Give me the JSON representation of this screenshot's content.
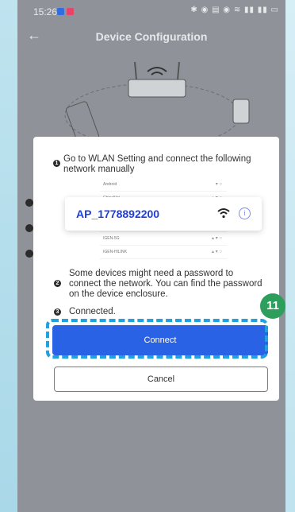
{
  "status_bar": {
    "time": "15:26",
    "right_indicators": "✱ ◉ ▤ ◉ ≋ ▮▮ ▮▮ ▭"
  },
  "app_bar": {
    "back_icon": "←",
    "title": "Device Configuration"
  },
  "modal": {
    "step1": {
      "number": "1",
      "text": "Go to WLAN Setting and connect the following network manually"
    },
    "wifi_list_rows": [
      "Android",
      "ChinaNet",
      "",
      "IGEN-5G",
      "IGEN-HILINK"
    ],
    "ap_card": {
      "ssid": "AP_1778892200",
      "info_icon": "i"
    },
    "step2": {
      "number": "2",
      "text": "Some devices might need a password to connect the network. You can find the password on the device enclosure."
    },
    "step3": {
      "number": "3",
      "text": "Connected."
    },
    "connect_label": "Connect",
    "cancel_label": "Cancel"
  },
  "annotation": {
    "badge": "11"
  },
  "colors": {
    "primary_blue": "#2a62e6",
    "highlight_dash": "#1fa2e0",
    "badge_green": "#2e9e5c"
  }
}
